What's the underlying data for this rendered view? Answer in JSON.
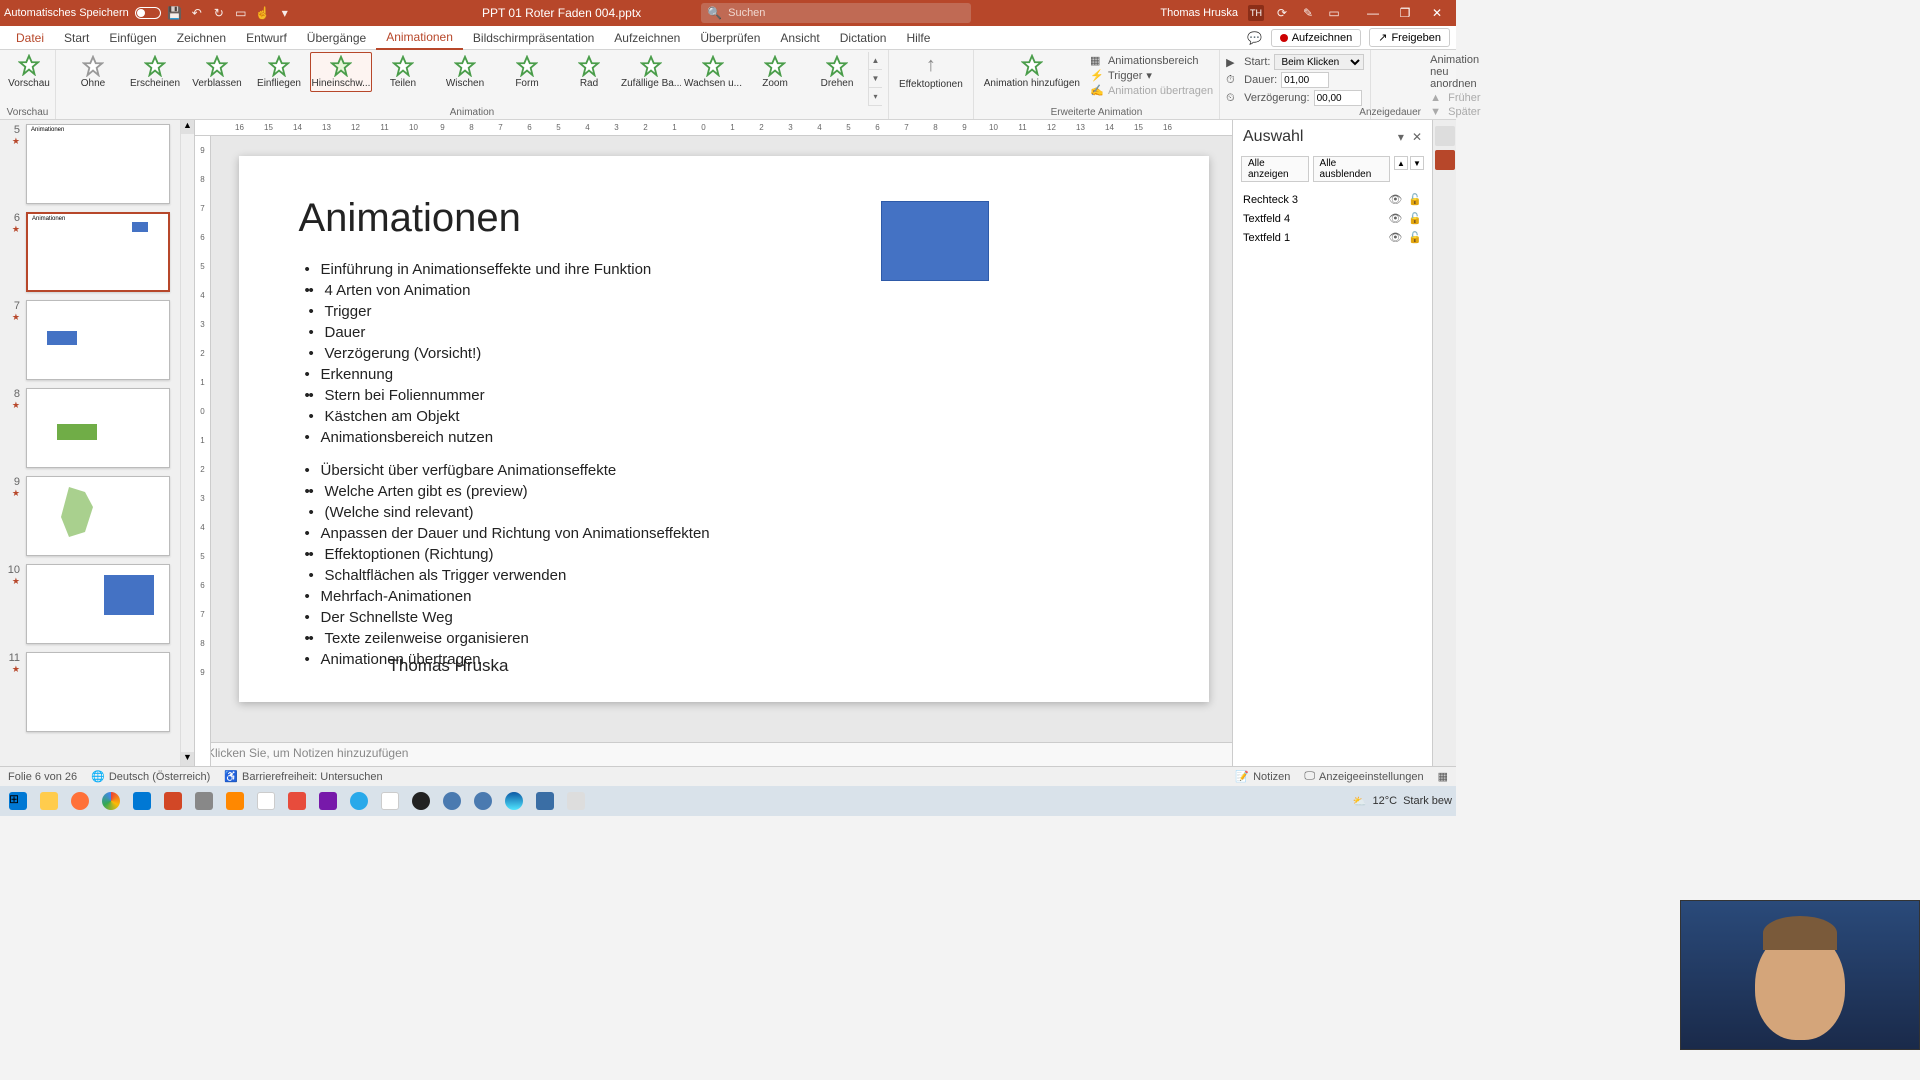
{
  "titlebar": {
    "autosave": "Automatisches Speichern",
    "doc_title": "PPT 01 Roter Faden 004.pptx",
    "search_placeholder": "Suchen",
    "user_name": "Thomas Hruska",
    "user_initials": "TH"
  },
  "menus": {
    "file": "Datei",
    "items": [
      "Start",
      "Einfügen",
      "Zeichnen",
      "Entwurf",
      "Übergänge",
      "Animationen",
      "Bildschirmpräsentation",
      "Aufzeichnen",
      "Überprüfen",
      "Ansicht",
      "Dictation",
      "Hilfe"
    ],
    "active": "Animationen",
    "record": "Aufzeichnen",
    "share": "Freigeben"
  },
  "ribbon": {
    "preview": "Vorschau",
    "gallery": [
      "Ohne",
      "Erscheinen",
      "Verblassen",
      "Einfliegen",
      "Hineinschw...",
      "Teilen",
      "Wischen",
      "Form",
      "Rad",
      "Zufällige Ba...",
      "Wachsen u...",
      "Zoom",
      "Drehen"
    ],
    "selected_index": 4,
    "effect_options": "Effektoptionen",
    "add_animation": "Animation hinzufügen",
    "anim_pane": "Animationsbereich",
    "trigger": "Trigger",
    "anim_painter": "Animation übertragen",
    "start_label": "Start:",
    "start_value": "Beim Klicken",
    "duration_label": "Dauer:",
    "duration_value": "01,00",
    "delay_label": "Verzögerung:",
    "delay_value": "00,00",
    "reorder": "Animation neu anordnen",
    "earlier": "Früher",
    "later": "Später",
    "group_preview": "Vorschau",
    "group_animation": "Animation",
    "group_advanced": "Erweiterte Animation",
    "group_timing": "Anzeigedauer"
  },
  "ruler_h": [
    "16",
    "15",
    "14",
    "13",
    "12",
    "11",
    "10",
    "9",
    "8",
    "7",
    "6",
    "5",
    "4",
    "3",
    "2",
    "1",
    "0",
    "1",
    "2",
    "3",
    "4",
    "5",
    "6",
    "7",
    "8",
    "9",
    "10",
    "11",
    "12",
    "13",
    "14",
    "15",
    "16"
  ],
  "ruler_v": [
    "9",
    "8",
    "7",
    "6",
    "5",
    "4",
    "3",
    "2",
    "1",
    "0",
    "1",
    "2",
    "3",
    "4",
    "5",
    "6",
    "7",
    "8",
    "9"
  ],
  "thumbs": [
    {
      "num": "5",
      "title": "Animationen"
    },
    {
      "num": "6",
      "title": "Animationen",
      "active": true
    },
    {
      "num": "7",
      "title": ""
    },
    {
      "num": "8",
      "title": ""
    },
    {
      "num": "9",
      "title": ""
    },
    {
      "num": "10",
      "title": ""
    },
    {
      "num": "11",
      "title": ""
    }
  ],
  "slide": {
    "title": "Animationen",
    "l1_0": "Einführung in Animationseffekte und ihre Funktion",
    "l2_0": "4 Arten von Animation",
    "l2_1": "Trigger",
    "l2_2": "Dauer",
    "l2_3": "Verzögerung (Vorsicht!)",
    "l1_1": "Erkennung",
    "l2_4": "Stern bei Foliennummer",
    "l2_5": "Kästchen am Objekt",
    "l1_2": "Animationsbereich nutzen",
    "l1_3": "Übersicht über verfügbare Animationseffekte",
    "l2_6": "Welche Arten gibt es (preview)",
    "l2_7": "(Welche sind relevant)",
    "l1_4": "Anpassen der Dauer und Richtung von Animationseffekten",
    "l2_8": "Effektoptionen (Richtung)",
    "l2_9": "Schaltflächen als Trigger verwenden",
    "l1_5": "Mehrfach-Animationen",
    "l1_6": "Der Schnellste Weg",
    "l2_10": "Texte zeilenweise organisieren",
    "l1_7": "Animationen übertragen",
    "footer": "Thomas Hruska"
  },
  "notes_placeholder": "Klicken Sie, um Notizen hinzuzufügen",
  "selection": {
    "title": "Auswahl",
    "show_all": "Alle anzeigen",
    "hide_all": "Alle ausblenden",
    "items": [
      "Rechteck 3",
      "Textfeld 4",
      "Textfeld 1"
    ]
  },
  "status": {
    "slide_info": "Folie 6 von 26",
    "language": "Deutsch (Österreich)",
    "accessibility": "Barrierefreiheit: Untersuchen",
    "notes": "Notizen",
    "display": "Anzeigeeinstellungen"
  },
  "taskbar": {
    "temp": "12°C",
    "weather_text": "Stark bew"
  }
}
